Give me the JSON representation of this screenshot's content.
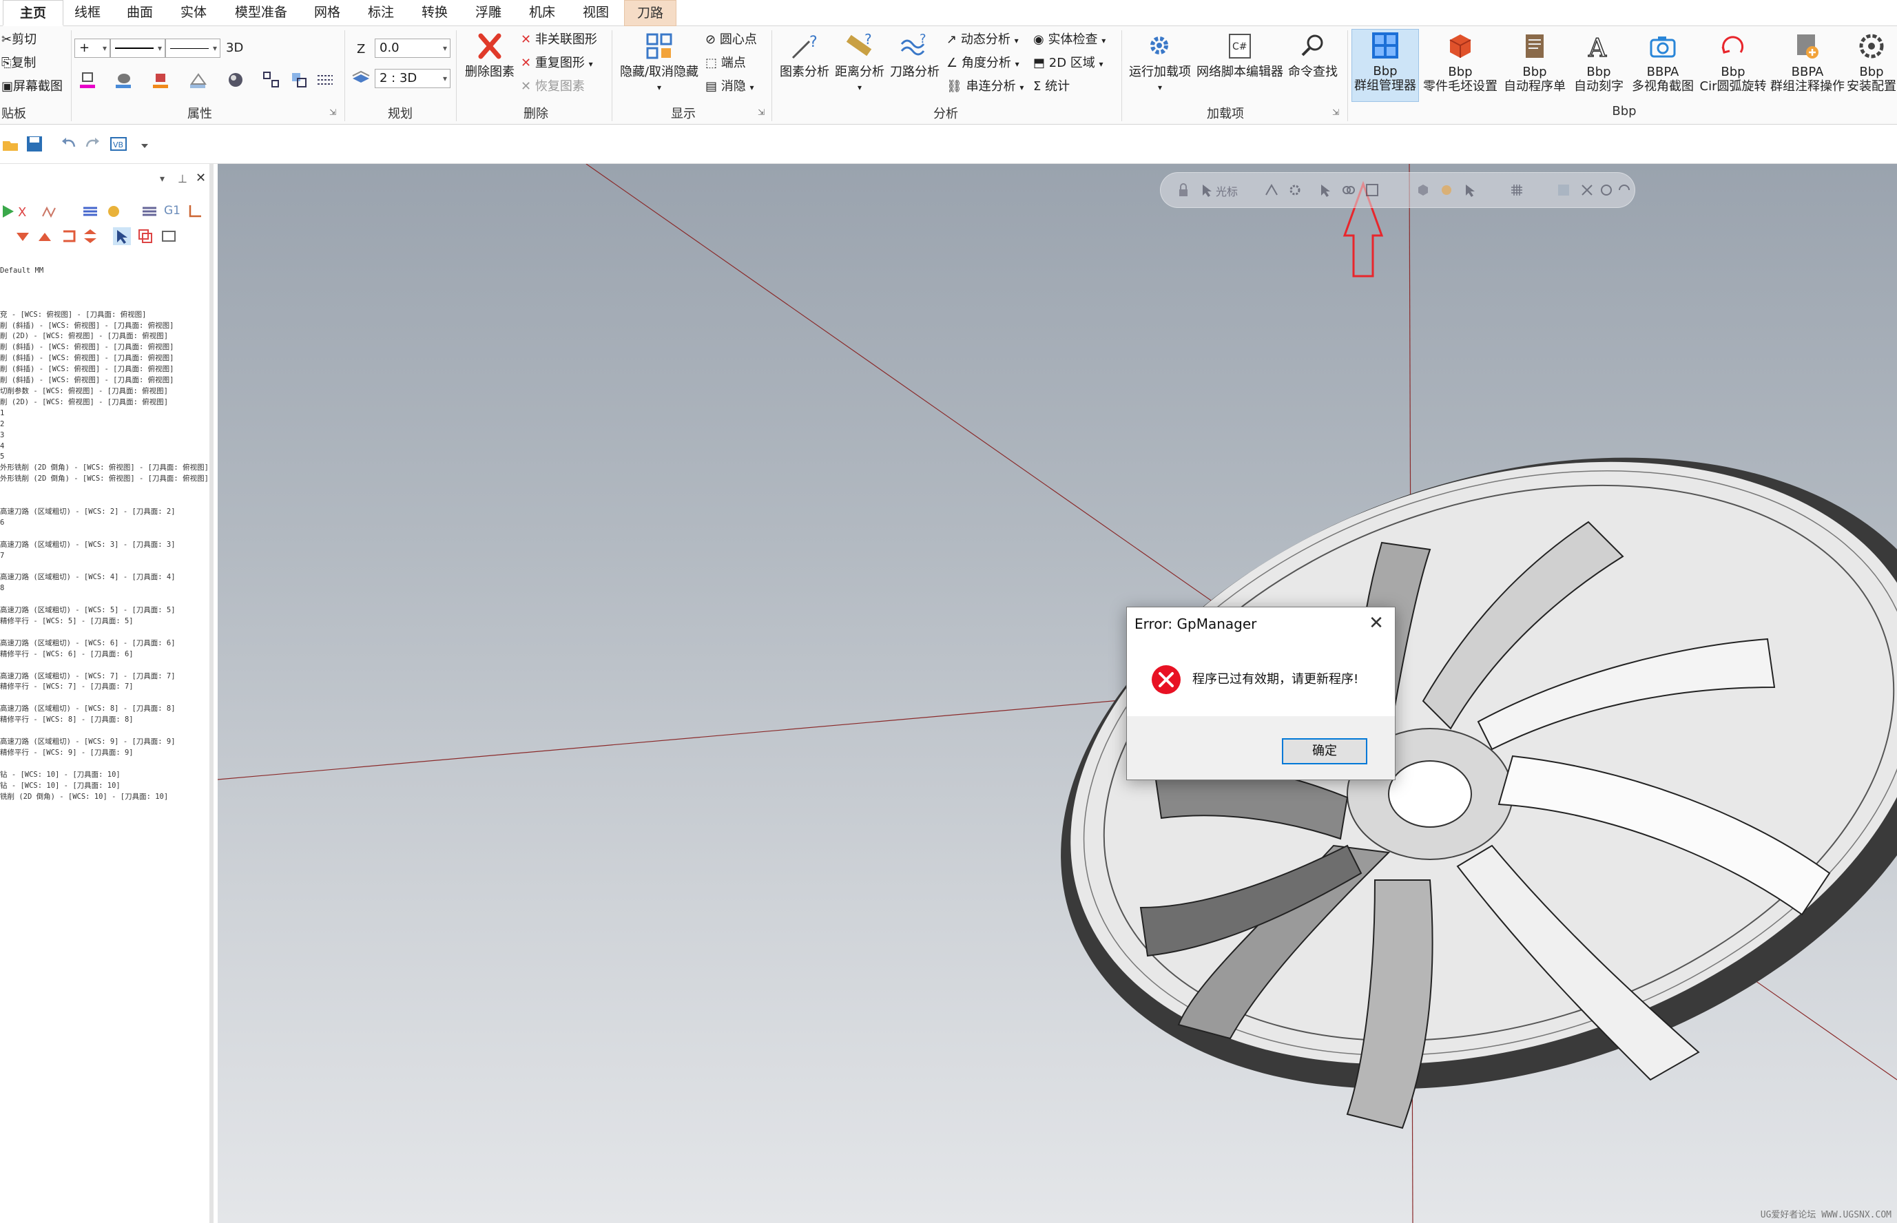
{
  "tabs": [
    "主页",
    "线框",
    "曲面",
    "实体",
    "模型准备",
    "网格",
    "标注",
    "转换",
    "浮雕",
    "机床",
    "视图",
    "刀路"
  ],
  "clipboard": {
    "cut": "剪切",
    "copy": "复制",
    "screenshot": "屏幕截图",
    "group": "贴板"
  },
  "attributes": {
    "group": "属性",
    "mode_3d": "3D"
  },
  "planning": {
    "group": "规划",
    "z_label": "Z",
    "z_value": "0.0",
    "plane_value": "2 : 3D"
  },
  "delete": {
    "group": "删除",
    "delete_entity": "删除图素",
    "unlink": "非关联图形",
    "duplicate": "重复图形",
    "restore": "恢复图素"
  },
  "display": {
    "group": "显示",
    "hide": "隐藏/取消隐藏",
    "center_point": "圆心点",
    "endpoint": "端点",
    "blank": "消隐"
  },
  "analysis": {
    "group": "分析",
    "entity_analysis": "图素分析",
    "distance_analysis": "距离分析",
    "toolpath_analysis": "刀路分析",
    "dynamic": "动态分析",
    "angle": "角度分析",
    "chain": "串连分析",
    "solid_check": "实体检查",
    "area_2d": "2D 区域",
    "stats": "统计"
  },
  "addins": {
    "group": "加载项",
    "run_addin": "运行加载项",
    "net_script": "网络脚本编辑器",
    "cmd_find": "命令查找"
  },
  "bbp": {
    "group": "Bbp",
    "items": [
      {
        "top": "Bbp",
        "bottom": "群组管理器"
      },
      {
        "top": "Bbp",
        "bottom": "零件毛坯设置"
      },
      {
        "top": "Bbp",
        "bottom": "自动程序单"
      },
      {
        "top": "Bbp",
        "bottom": "自动刻字"
      },
      {
        "top": "BBPA",
        "bottom": "多视角截图"
      },
      {
        "top": "Bbp",
        "bottom": "Cir圆弧旋转"
      },
      {
        "top": "BBPA",
        "bottom": "群组注释操作"
      },
      {
        "top": "Bbp",
        "bottom": "安装配置"
      }
    ]
  },
  "viewport_toolbar": {
    "cursor_label": "光标"
  },
  "panel": {
    "header": "Default MM",
    "log_lines": [
      "",
      "",
      "",
      "兗 - [WCS: 俯视图] - [刀具面: 俯视图]",
      "削 (斜插) - [WCS: 俯视图] - [刀具面: 俯视图]",
      "削 (2D) - [WCS: 俯视图] - [刀具面: 俯视图]",
      "削 (斜插) - [WCS: 俯视图] - [刀具面: 俯视图]",
      "削 (斜插) - [WCS: 俯视图] - [刀具面: 俯视图]",
      "削 (斜插) - [WCS: 俯视图] - [刀具面: 俯视图]",
      "削 (斜插) - [WCS: 俯视图] - [刀具面: 俯视图]",
      "切削参数 - [WCS: 俯视图] - [刀具面: 俯视图]",
      "削 (2D) - [WCS: 俯视图] - [刀具面: 俯视图]",
      "1",
      "2",
      "3",
      "4",
      "5",
      "外形铣削 (2D 倒角) - [WCS: 俯视图] - [刀具面: 俯视图]",
      "外形铣削 (2D 倒角) - [WCS: 俯视图] - [刀具面: 俯视图]",
      "",
      "",
      "高速刀路 (区域粗切) - [WCS: 2] - [刀具面: 2]",
      "6",
      "",
      "高速刀路 (区域粗切) - [WCS: 3] - [刀具面: 3]",
      "7",
      "",
      "高速刀路 (区域粗切) - [WCS: 4] - [刀具面: 4]",
      "8",
      "",
      "高速刀路 (区域粗切) - [WCS: 5] - [刀具面: 5]",
      "精修平行 - [WCS: 5] - [刀具面: 5]",
      "",
      "高速刀路 (区域粗切) - [WCS: 6] - [刀具面: 6]",
      "精修平行 - [WCS: 6] - [刀具面: 6]",
      "",
      "高速刀路 (区域粗切) - [WCS: 7] - [刀具面: 7]",
      "精修平行 - [WCS: 7] - [刀具面: 7]",
      "",
      "高速刀路 (区域粗切) - [WCS: 8] - [刀具面: 8]",
      "精修平行 - [WCS: 8] - [刀具面: 8]",
      "",
      "高速刀路 (区域粗切) - [WCS: 9] - [刀具面: 9]",
      "精修平行 - [WCS: 9] - [刀具面: 9]",
      "",
      "钻 - [WCS: 10] - [刀具面: 10]",
      "钻 - [WCS: 10] - [刀具面: 10]",
      "铣削 (2D 倒角) - [WCS: 10] - [刀具面: 10]"
    ]
  },
  "dialog": {
    "title": "Error: GpManager",
    "message": "程序已过有效期，请更新程序!",
    "ok": "确定"
  },
  "watermark": "UG爱好者论坛 WWW.UGSNX.COM",
  "colors": {
    "accent": "#0078d7",
    "error": "#e81123",
    "annotation_arrow": "#e8262c",
    "tab_orange": "#f5dcc6"
  }
}
